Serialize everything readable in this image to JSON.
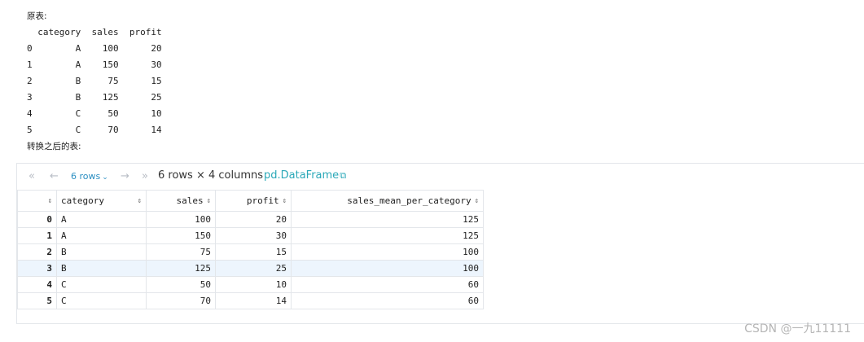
{
  "original_label": "原表:",
  "original_table": {
    "header": "  category  sales  profit",
    "rows": [
      "0        A    100      20",
      "1        A    150      30",
      "2        B     75      15",
      "3        B    125      25",
      "4        C     50      10",
      "5        C     70      14"
    ]
  },
  "transformed_label": "转换之后的表:",
  "toolbar": {
    "rows_selector": "6 rows",
    "shape": "6 rows × 4 columns",
    "link": "pd.DataFrame"
  },
  "grid": {
    "columns": [
      "",
      "category",
      "sales",
      "profit",
      "sales_mean_per_category"
    ],
    "rows": [
      [
        "0",
        "A",
        "100",
        "20",
        "125"
      ],
      [
        "1",
        "A",
        "150",
        "30",
        "125"
      ],
      [
        "2",
        "B",
        "75",
        "15",
        "100"
      ],
      [
        "3",
        "B",
        "125",
        "25",
        "100"
      ],
      [
        "4",
        "C",
        "50",
        "10",
        "60"
      ],
      [
        "5",
        "C",
        "70",
        "14",
        "60"
      ]
    ],
    "highlight_row_index": 3
  },
  "watermark": "CSDN @一九11111",
  "colors": {
    "accent": "#2c8fc2",
    "link": "#2aa8b8",
    "highlight": "#edf5fd",
    "border": "#e3e6ea"
  },
  "icons": [
    "first-page-icon",
    "prev-page-icon",
    "chevron-down-icon",
    "next-page-icon",
    "last-page-icon",
    "external-link-icon",
    "sort-icon"
  ]
}
